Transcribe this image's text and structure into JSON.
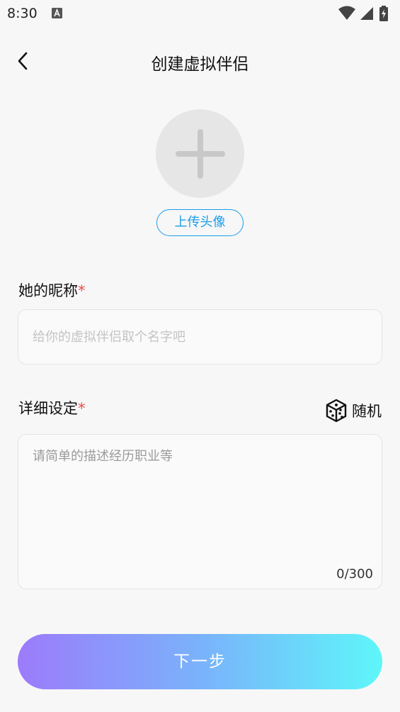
{
  "status_bar": {
    "time": "8:30",
    "icons": [
      "a-notification-icon",
      "wifi-icon",
      "signal-icon",
      "battery-charging-icon"
    ]
  },
  "header": {
    "title": "创建虚拟伴侣",
    "back_icon": "chevron-left-icon"
  },
  "avatar": {
    "icon": "plus-icon",
    "upload_label": "上传头像"
  },
  "nickname": {
    "label": "她的昵称",
    "required_mark": "*",
    "placeholder": "给你的虚拟伴侣取个名字吧",
    "value": ""
  },
  "details": {
    "label": "详细设定",
    "required_mark": "*",
    "random_label": "随机",
    "random_icon": "dice-icon",
    "placeholder": "请简单的描述经历职业等",
    "value": "",
    "char_count": "0/300"
  },
  "next_button": {
    "label": "下一步"
  },
  "colors": {
    "accent_blue": "#1a9de8",
    "required_red": "#f04a4a",
    "gradient_start": "#9c7bfb",
    "gradient_end": "#5ef6f9"
  }
}
